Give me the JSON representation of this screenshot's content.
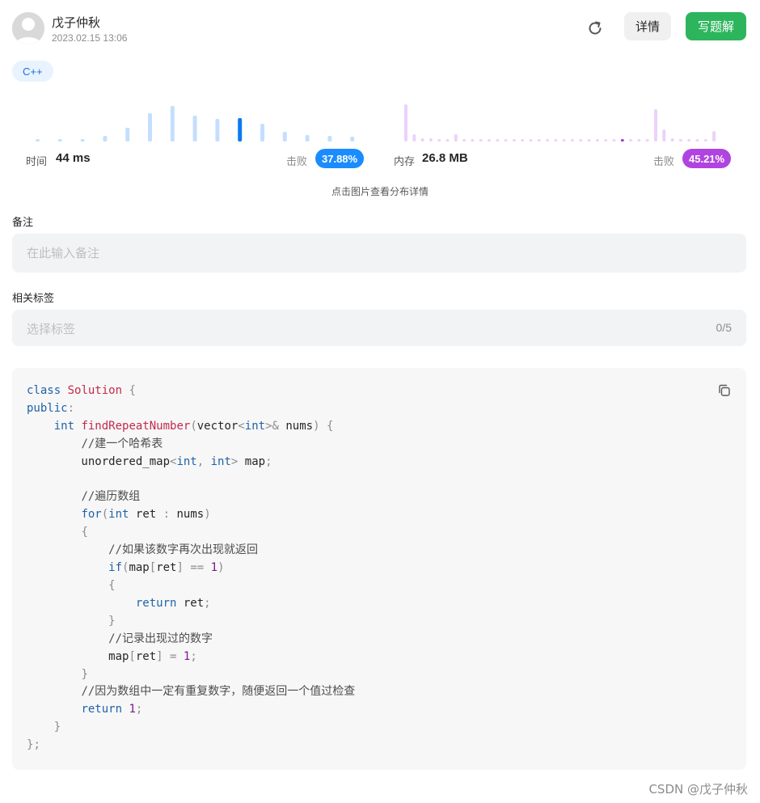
{
  "header": {
    "username": "戊子仲秋",
    "datetime": "2023.02.15 13:06",
    "detail_label": "详情",
    "write_label": "写题解"
  },
  "language_tag": "C++",
  "stats": {
    "time": {
      "label": "时间",
      "value": "44 ms",
      "beat_label": "击败",
      "beat_percent": "37.88%",
      "color": "#1a8cff",
      "bar_color": "#c4dffd",
      "highlight_color": "#0a7bf0",
      "bar_heights": [
        3,
        3,
        3,
        7,
        17,
        35,
        44,
        32,
        28,
        29,
        22,
        12,
        8,
        7,
        6
      ],
      "highlight_index": 9
    },
    "memory": {
      "label": "内存",
      "value": "26.8 MB",
      "beat_label": "击败",
      "beat_percent": "45.21%",
      "color": "#b044e0",
      "bar_color": "#ecd1fb",
      "highlight_color": "#a033cc",
      "bar_heights": [
        46,
        9,
        4,
        4,
        3,
        3,
        9,
        3,
        3,
        3,
        3,
        3,
        3,
        3,
        3,
        3,
        3,
        3,
        3,
        3,
        3,
        3,
        3,
        3,
        3,
        3,
        3,
        3,
        3,
        3,
        40,
        15,
        4,
        3,
        3,
        3,
        3,
        13
      ],
      "highlight_index": 26
    }
  },
  "hint": "点击图片查看分布详情",
  "note": {
    "label": "备注",
    "placeholder": "在此输入备注"
  },
  "tags": {
    "label": "相关标签",
    "placeholder": "选择标签",
    "count": "0/5"
  },
  "code_lines": [
    "class Solution {",
    "public:",
    "    int findRepeatNumber(vector<int>& nums) {",
    "        //建一个哈希表",
    "        unordered_map<int, int> map;",
    "",
    "        //遍历数组",
    "        for(int ret : nums)",
    "        {",
    "            //如果该数字再次出现就返回",
    "            if(map[ret] == 1)",
    "            {",
    "                return ret;",
    "            }",
    "            //记录出现过的数字",
    "            map[ret] = 1;",
    "        }",
    "        //因为数组中一定有重复数字，随便返回一个值过检查",
    "        return 1;",
    "    }",
    "};"
  ],
  "footer": "CSDN @戊子仲秋"
}
